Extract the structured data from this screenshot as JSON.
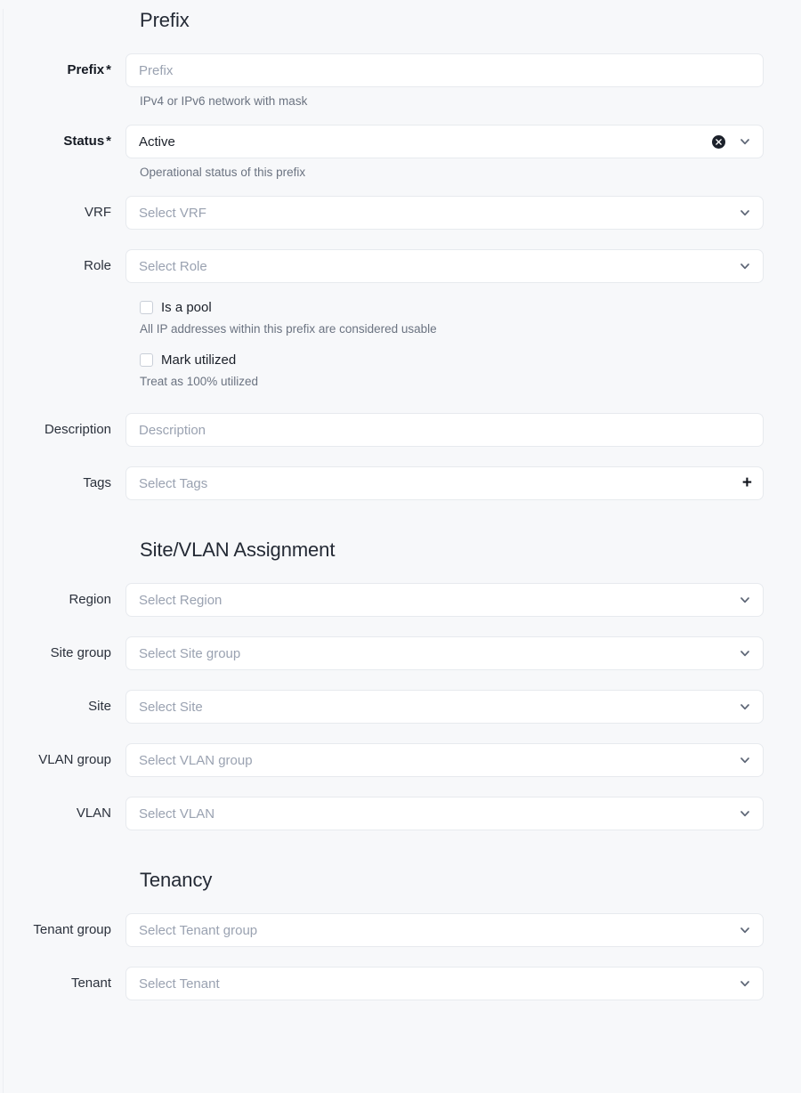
{
  "theme": {
    "page_background": "#f7f8fa",
    "field_background": "#ffffff",
    "field_border": "#e7eaee",
    "placeholder_color": "#9aa2b1",
    "help_text_color": "#6b7381",
    "label_color": "#2b313c",
    "heading_color": "#242a35",
    "clear_button_color": "#1c212b"
  },
  "sections": [
    {
      "id": "prefix",
      "title": "Prefix",
      "fields": [
        {
          "id": "prefix",
          "label": "Prefix",
          "required": true,
          "required_marker": "*",
          "type": "text",
          "value": "",
          "placeholder": "Prefix",
          "help": "IPv4 or IPv6 network with mask",
          "icons": []
        },
        {
          "id": "status",
          "label": "Status",
          "required": true,
          "required_marker": "*",
          "type": "select",
          "value": "Active",
          "placeholder": "",
          "help": "Operational status of this prefix",
          "icons": [
            "clear-icon",
            "chevron-down-icon"
          ]
        },
        {
          "id": "vrf",
          "label": "VRF",
          "required": false,
          "type": "select",
          "value": "",
          "placeholder": "Select VRF",
          "help": "",
          "icons": [
            "chevron-down-icon"
          ]
        },
        {
          "id": "role",
          "label": "Role",
          "required": false,
          "type": "select",
          "value": "",
          "placeholder": "Select Role",
          "help": "",
          "icons": [
            "chevron-down-icon"
          ]
        }
      ],
      "checkboxes": [
        {
          "id": "is-a-pool",
          "label": "Is a pool",
          "checked": false,
          "help": "All IP addresses within this prefix are considered usable"
        },
        {
          "id": "mark-utilized",
          "label": "Mark utilized",
          "checked": false,
          "help": "Treat as 100% utilized"
        }
      ],
      "fields_after": [
        {
          "id": "description",
          "label": "Description",
          "required": false,
          "type": "text",
          "value": "",
          "placeholder": "Description",
          "help": "",
          "icons": []
        },
        {
          "id": "tags",
          "label": "Tags",
          "required": false,
          "type": "tags",
          "value": "",
          "placeholder": "Select Tags",
          "help": "",
          "icons": [
            "plus-icon"
          ]
        }
      ]
    },
    {
      "id": "site-vlan-assignment",
      "title": "Site/VLAN Assignment",
      "fields": [
        {
          "id": "region",
          "label": "Region",
          "required": false,
          "type": "select",
          "value": "",
          "placeholder": "Select Region",
          "help": "",
          "icons": [
            "chevron-down-icon"
          ]
        },
        {
          "id": "site-group",
          "label": "Site group",
          "required": false,
          "type": "select",
          "value": "",
          "placeholder": "Select Site group",
          "help": "",
          "icons": [
            "chevron-down-icon"
          ]
        },
        {
          "id": "site",
          "label": "Site",
          "required": false,
          "type": "select",
          "value": "",
          "placeholder": "Select Site",
          "help": "",
          "icons": [
            "chevron-down-icon"
          ]
        },
        {
          "id": "vlan-group",
          "label": "VLAN group",
          "required": false,
          "type": "select",
          "value": "",
          "placeholder": "Select VLAN group",
          "help": "",
          "icons": [
            "chevron-down-icon"
          ]
        },
        {
          "id": "vlan",
          "label": "VLAN",
          "required": false,
          "type": "select",
          "value": "",
          "placeholder": "Select VLAN",
          "help": "",
          "icons": [
            "chevron-down-icon"
          ]
        }
      ]
    },
    {
      "id": "tenancy",
      "title": "Tenancy",
      "fields": [
        {
          "id": "tenant-group",
          "label": "Tenant group",
          "required": false,
          "type": "select",
          "value": "",
          "placeholder": "Select Tenant group",
          "help": "",
          "icons": [
            "chevron-down-icon"
          ]
        },
        {
          "id": "tenant",
          "label": "Tenant",
          "required": false,
          "type": "select",
          "value": "",
          "placeholder": "Select Tenant",
          "help": "",
          "icons": [
            "chevron-down-icon"
          ]
        }
      ]
    }
  ]
}
